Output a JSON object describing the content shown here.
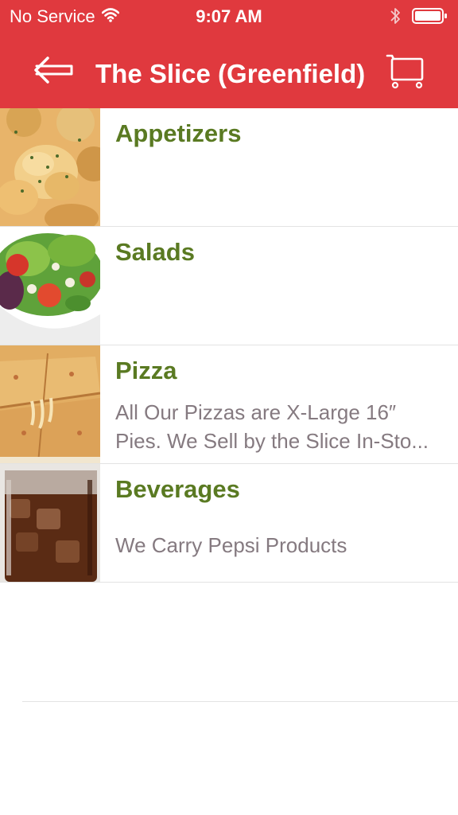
{
  "status_bar": {
    "carrier": "No Service",
    "time": "9:07 AM"
  },
  "nav": {
    "title": "The Slice (Greenfield)",
    "back_icon": "arrow-left-icon",
    "cart_icon": "cart-icon"
  },
  "categories": [
    {
      "title": "Appetizers",
      "description": ""
    },
    {
      "title": "Salads",
      "description": ""
    },
    {
      "title": "Pizza",
      "description_line1": "All Our Pizzas are X-Large 16″",
      "description_line2": "Pies. We Sell by the Slice In-Sto..."
    },
    {
      "title": "Beverages",
      "description": "We Carry Pepsi Products"
    }
  ],
  "colors": {
    "header": "#e0393e",
    "title_green": "#5a7a22",
    "desc_gray": "#857a80"
  }
}
